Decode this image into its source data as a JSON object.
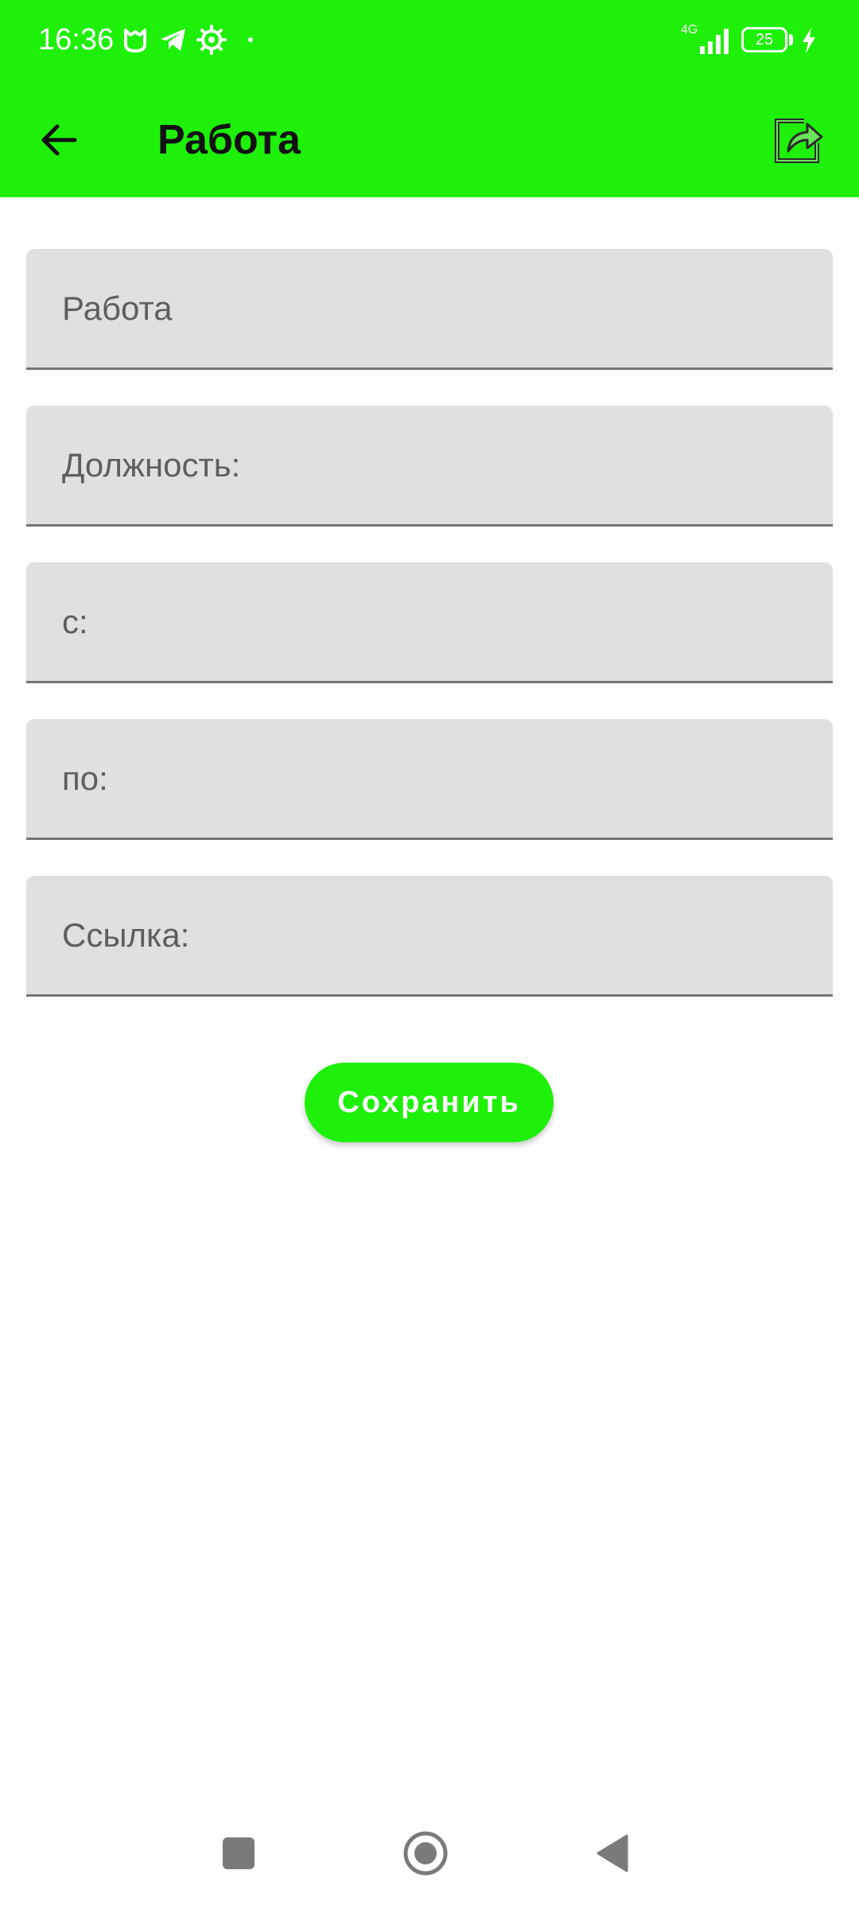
{
  "status_bar": {
    "time": "16:36",
    "network": "4G",
    "battery_level": "25",
    "icons": [
      "mi-icon",
      "telegram-icon",
      "settings-gear-icon",
      "signal-icon",
      "battery-icon",
      "charging-icon"
    ]
  },
  "app_bar": {
    "title": "Работа",
    "back_icon": "arrow-back-icon",
    "share_icon": "share-icon"
  },
  "form": {
    "fields": [
      {
        "placeholder": "Работа",
        "value": ""
      },
      {
        "placeholder": "Должность:",
        "value": ""
      },
      {
        "placeholder": "с:",
        "value": ""
      },
      {
        "placeholder": "по:",
        "value": ""
      },
      {
        "placeholder": "Ссылка:",
        "value": ""
      }
    ],
    "save_label": "Сохранить"
  },
  "colors": {
    "accent": "#1ef00a",
    "field_background": "#e0e0e0",
    "field_underline": "#757575"
  },
  "nav_bar": {
    "icons": [
      "recents-square-icon",
      "home-circle-icon",
      "back-triangle-icon"
    ]
  }
}
